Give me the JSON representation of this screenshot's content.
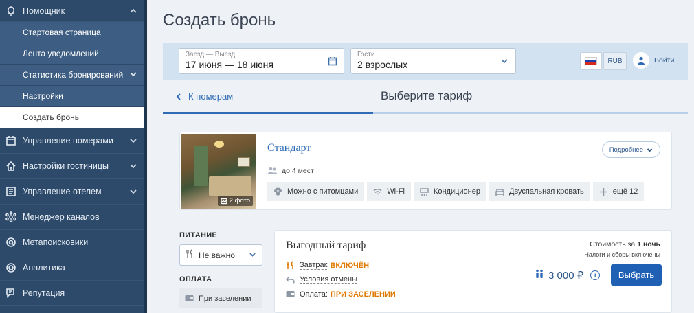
{
  "sidebar": {
    "assistant": "Помощник",
    "sub": [
      {
        "label": "Стартовая страница"
      },
      {
        "label": "Лента уведомлений"
      },
      {
        "label": "Статистика бронирований"
      },
      {
        "label": "Настройки"
      },
      {
        "label": "Создать бронь"
      }
    ],
    "items": [
      {
        "label": "Управление номерами",
        "icon": "calendar-icon"
      },
      {
        "label": "Настройки гостиницы",
        "icon": "home-icon"
      },
      {
        "label": "Управление отелем",
        "icon": "list-icon"
      },
      {
        "label": "Менеджер каналов",
        "icon": "network-icon"
      },
      {
        "label": "Метапоисковики",
        "icon": "search-icon"
      },
      {
        "label": "Аналитика",
        "icon": "analytics-icon"
      },
      {
        "label": "Репутация",
        "icon": "chat-icon"
      }
    ]
  },
  "header": {
    "title": "Создать бронь"
  },
  "search": {
    "dates_label": "Заезд — Выезд",
    "dates_value": "17 июня — 18 июня",
    "guests_label": "Гости",
    "guests_value": "2 взрослых",
    "currency": "RUB",
    "login": "Войти"
  },
  "nav": {
    "back": "К номерам",
    "step_title": "Выберите тариф",
    "progress": 0.4
  },
  "room": {
    "name": "Стандарт",
    "more": "Подробнее",
    "capacity": "до 4 мест",
    "photos": "2 фото",
    "amenities": [
      {
        "label": "Можно с питомцами",
        "icon": "paw-icon"
      },
      {
        "label": "Wi-Fi",
        "icon": "wifi-icon"
      },
      {
        "label": "Кондиционер",
        "icon": "ac-icon"
      },
      {
        "label": "Двуспальная кровать",
        "icon": "bed-icon"
      },
      {
        "label": "ещё 12",
        "icon": "plus-icon"
      }
    ]
  },
  "filters": {
    "food_label": "ПИТАНИЕ",
    "food_value": "Не важно",
    "payment_label": "ОПЛАТА",
    "payment_value": "При заселении"
  },
  "tariff": {
    "name": "Выгодный тариф",
    "breakfast": "Завтрак",
    "breakfast_status": "ВКЛЮЧЁН",
    "cancel": "Условия отмены",
    "payment": "Оплата:",
    "payment_status": "ПРИ ЗАСЕЛЕНИИ",
    "cost_prefix": "Стоимость за",
    "cost_period": "1 ночь",
    "taxes": "Налоги и сборы включены",
    "price": "3 000 ₽",
    "info": "i",
    "book": "Выбрать"
  },
  "colors": {
    "accent": "#1f5fb4",
    "sidebar": "#2d4a6b",
    "highlight": "#e07800"
  }
}
